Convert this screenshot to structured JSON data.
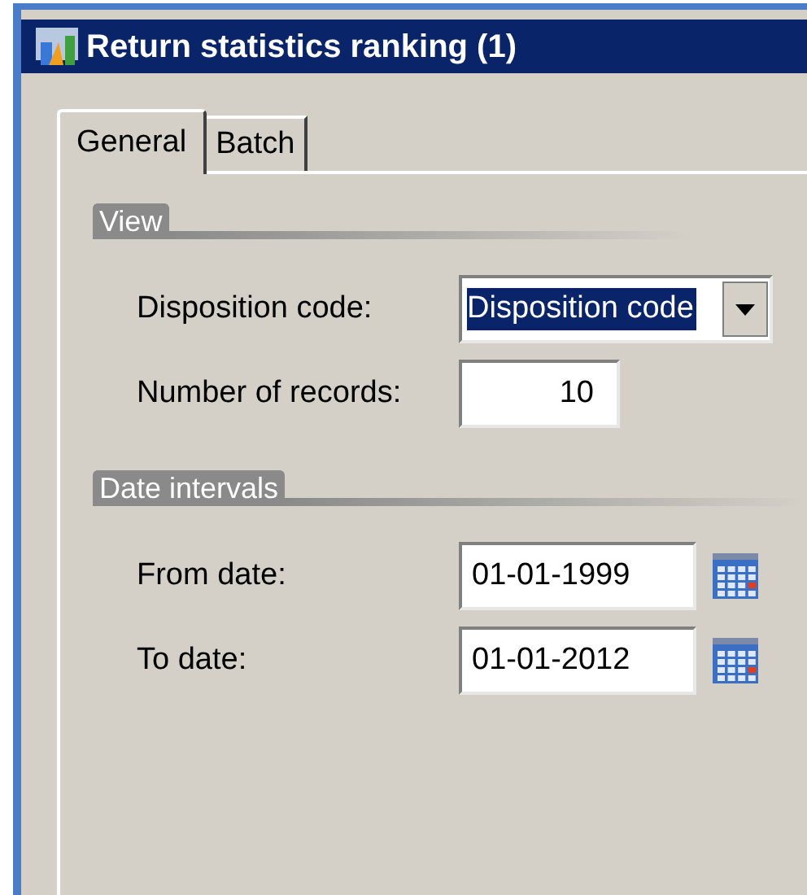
{
  "window": {
    "title": "Return statistics ranking (1)"
  },
  "tabs": [
    {
      "label": "General",
      "selected": true
    },
    {
      "label": "Batch",
      "selected": false
    }
  ],
  "groups": [
    {
      "title": "View",
      "fields": [
        {
          "kind": "combo",
          "label": "Disposition code:",
          "value": "Disposition code"
        },
        {
          "kind": "number",
          "label": "Number of records:",
          "value": "10"
        }
      ]
    },
    {
      "title": "Date intervals",
      "fields": [
        {
          "kind": "date",
          "label": "From date:",
          "value": "01-01-1999"
        },
        {
          "kind": "date",
          "label": "To date:",
          "value": "01-01-2012"
        }
      ]
    }
  ]
}
